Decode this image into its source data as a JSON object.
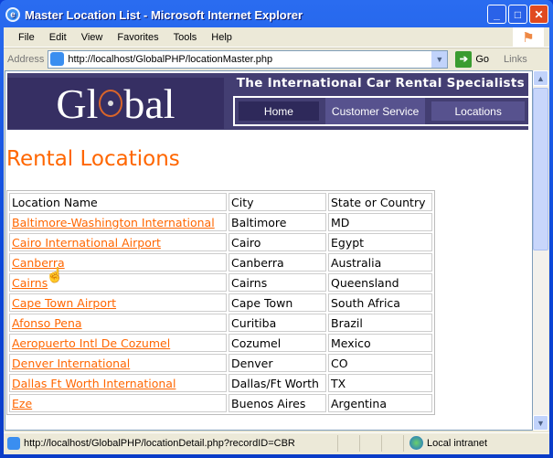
{
  "window": {
    "title": "Master Location List - Microsoft Internet Explorer"
  },
  "menu": [
    "File",
    "Edit",
    "View",
    "Favorites",
    "Tools",
    "Help"
  ],
  "address": {
    "label": "Address",
    "url": "http://localhost/GlobalPHP/locationMaster.php",
    "go": "Go",
    "links": "Links"
  },
  "banner": {
    "logo": "Global",
    "tagline": "The International Car Rental Specialists",
    "nav": [
      "Home",
      "Customer Service",
      "Locations"
    ]
  },
  "page": {
    "heading": "Rental Locations"
  },
  "table": {
    "headers": [
      "Location Name",
      "City",
      "State or Country"
    ],
    "rows": [
      [
        "Baltimore-Washington International",
        "Baltimore",
        "MD"
      ],
      [
        "Cairo International Airport",
        "Cairo",
        "Egypt"
      ],
      [
        "Canberra",
        "Canberra",
        "Australia"
      ],
      [
        "Cairns",
        "Cairns",
        "Queensland"
      ],
      [
        "Cape Town Airport",
        "Cape Town",
        "South Africa"
      ],
      [
        "Afonso Pena",
        "Curitiba",
        "Brazil"
      ],
      [
        "Aeropuerto Intl De Cozumel",
        "Cozumel",
        "Mexico"
      ],
      [
        "Denver International",
        "Denver",
        "CO"
      ],
      [
        "Dallas Ft Worth International",
        "Dallas/Ft Worth",
        "TX"
      ],
      [
        "Eze",
        "Buenos Aires",
        "Argentina"
      ]
    ]
  },
  "status": {
    "url": "http://localhost/GlobalPHP/locationDetail.php?recordID=CBR",
    "zone": "Local intranet"
  },
  "colors": {
    "accent": "#ff6600",
    "banner": "#433e72"
  }
}
